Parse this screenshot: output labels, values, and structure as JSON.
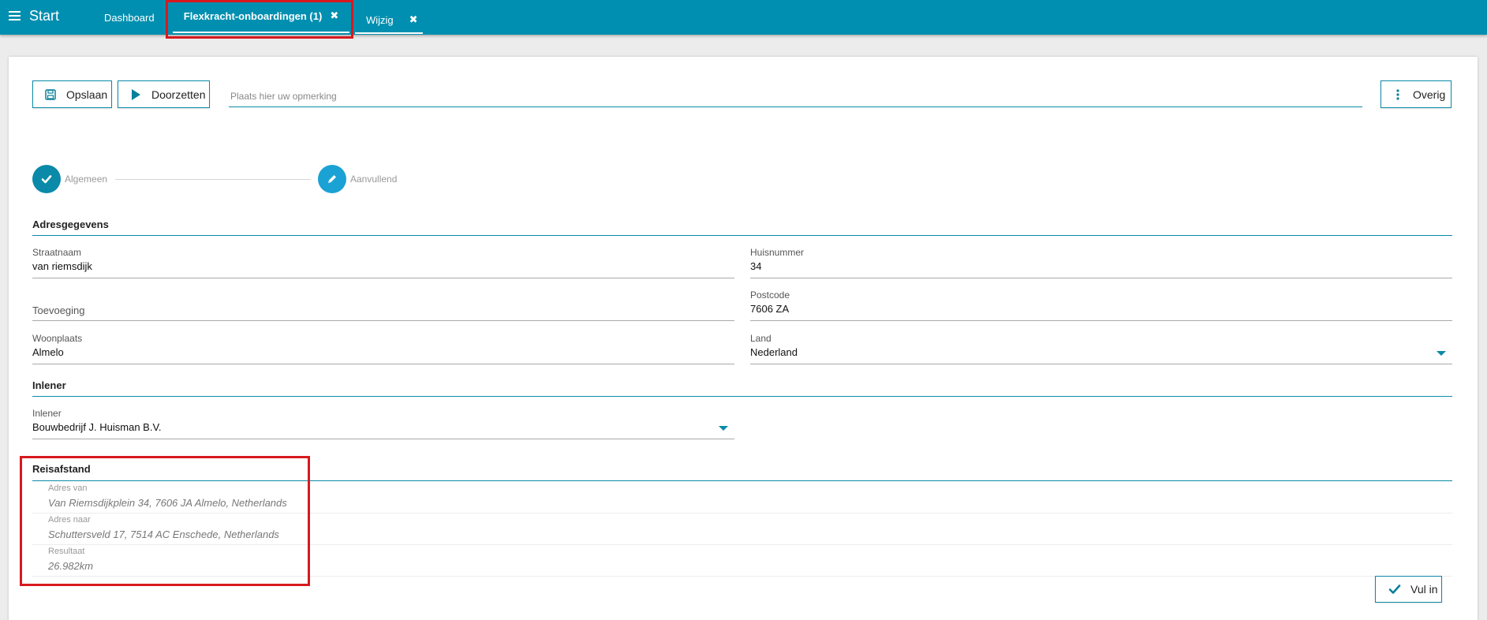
{
  "topbar": {
    "start_label": "Start",
    "tabs": [
      {
        "label": "Dashboard"
      },
      {
        "label": "Flexkracht-onboardingen (1)"
      },
      {
        "label": "Wijzig"
      }
    ],
    "close_glyph": "✖"
  },
  "toolbar": {
    "save_label": "Opslaan",
    "forward_label": "Doorzetten",
    "remark_placeholder": "Plaats hier uw opmerking",
    "more_label": "Overig"
  },
  "steps": [
    {
      "label": "Algemeen",
      "icon": "check-icon",
      "state": "done"
    },
    {
      "label": "Aanvullend",
      "icon": "pencil-icon",
      "state": "active"
    }
  ],
  "address": {
    "title": "Adresgegevens",
    "street": {
      "label": "Straatnaam",
      "value": "van riemsdijk"
    },
    "house_number": {
      "label": "Huisnummer",
      "value": "34"
    },
    "suffix": {
      "label": "Toevoeging",
      "value": ""
    },
    "postcode": {
      "label": "Postcode",
      "value": "7606 ZA"
    },
    "city": {
      "label": "Woonplaats",
      "value": "Almelo"
    },
    "country": {
      "label": "Land",
      "value": "Nederland"
    }
  },
  "inlener": {
    "title": "Inlener",
    "field": {
      "label": "Inlener",
      "value": "Bouwbedrijf J. Huisman B.V."
    }
  },
  "travel": {
    "title": "Reisafstand",
    "rows": [
      {
        "label": "Adres van",
        "value": "Van Riemsdijkplein 34, 7606 JA Almelo, Netherlands"
      },
      {
        "label": "Adres naar",
        "value": "Schuttersveld 17, 7514 AC Enschede, Netherlands"
      },
      {
        "label": "Resultaat",
        "value": "26.982km"
      }
    ],
    "fill_label": "Vul in"
  },
  "colors": {
    "accent": "#008fb0",
    "step_active": "#1ba2d4",
    "highlight": "#d7191f"
  }
}
